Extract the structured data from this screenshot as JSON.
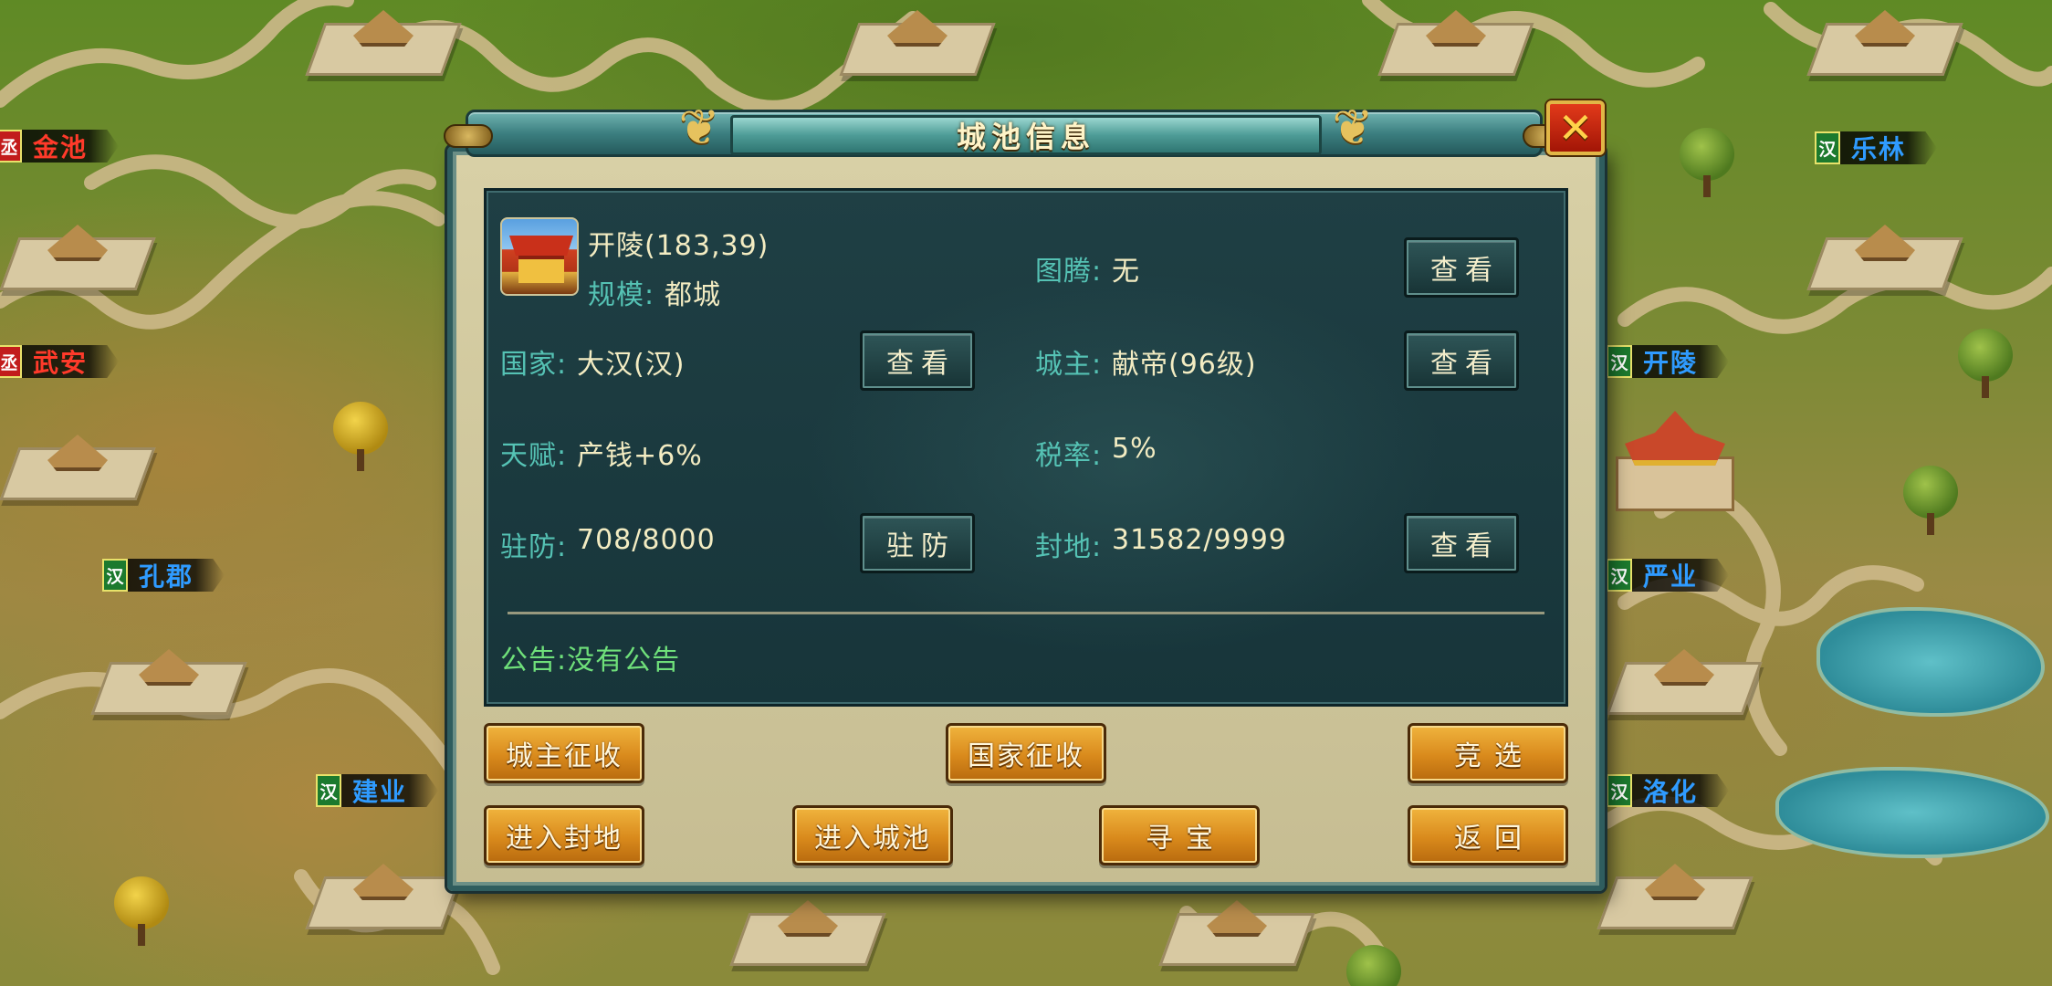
{
  "dialog": {
    "title": "城池信息",
    "close_glyph": "✕",
    "city": {
      "name": "开陵(183,39)",
      "scale_label": "规模:",
      "scale_value": "都城"
    },
    "fields": {
      "country_label": "国家:",
      "country_value": "大汉(汉)",
      "talent_label": "天赋:",
      "talent_value": "产钱+6%",
      "garrison_label": "驻防:",
      "garrison_value": "708/8000",
      "totem_label": "图腾:",
      "totem_value": "无",
      "lord_label": "城主:",
      "lord_value": "献帝(96级)",
      "tax_label": "税率:",
      "tax_value": "5%",
      "fief_label": "封地:",
      "fief_value": "31582/9999"
    },
    "view_label": "查看",
    "garrison_button": "驻防",
    "notice": "公告:没有公告",
    "buttons": {
      "lord_collect": "城主征收",
      "national_collect": "国家征收",
      "campaign": "竞选",
      "enter_fief": "进入封地",
      "enter_city": "进入城池",
      "treasure": "寻宝",
      "back": "返回"
    }
  },
  "map": {
    "labels": [
      {
        "flag": "丞",
        "name": "金池",
        "flag_color": "#c21c1c",
        "name_color": "#ff3a2a"
      },
      {
        "flag": "丞",
        "name": "武安",
        "flag_color": "#c21c1c",
        "name_color": "#ff3a2a"
      },
      {
        "flag": "汉",
        "name": "孔郡",
        "flag_color": "#1c7a2e",
        "name_color": "#2f9bff"
      },
      {
        "flag": "汉",
        "name": "建业",
        "flag_color": "#1c7a2e",
        "name_color": "#2f9bff"
      },
      {
        "flag": "汉",
        "name": "乐林",
        "flag_color": "#1c7a2e",
        "name_color": "#2f9bff"
      },
      {
        "flag": "汉",
        "name": "开陵",
        "flag_color": "#1c7a2e",
        "name_color": "#2f9bff"
      },
      {
        "flag": "汉",
        "name": "严业",
        "flag_color": "#1c7a2e",
        "name_color": "#2f9bff"
      },
      {
        "flag": "汉",
        "name": "洛化",
        "flag_color": "#1c7a2e",
        "name_color": "#2f9bff"
      }
    ]
  }
}
